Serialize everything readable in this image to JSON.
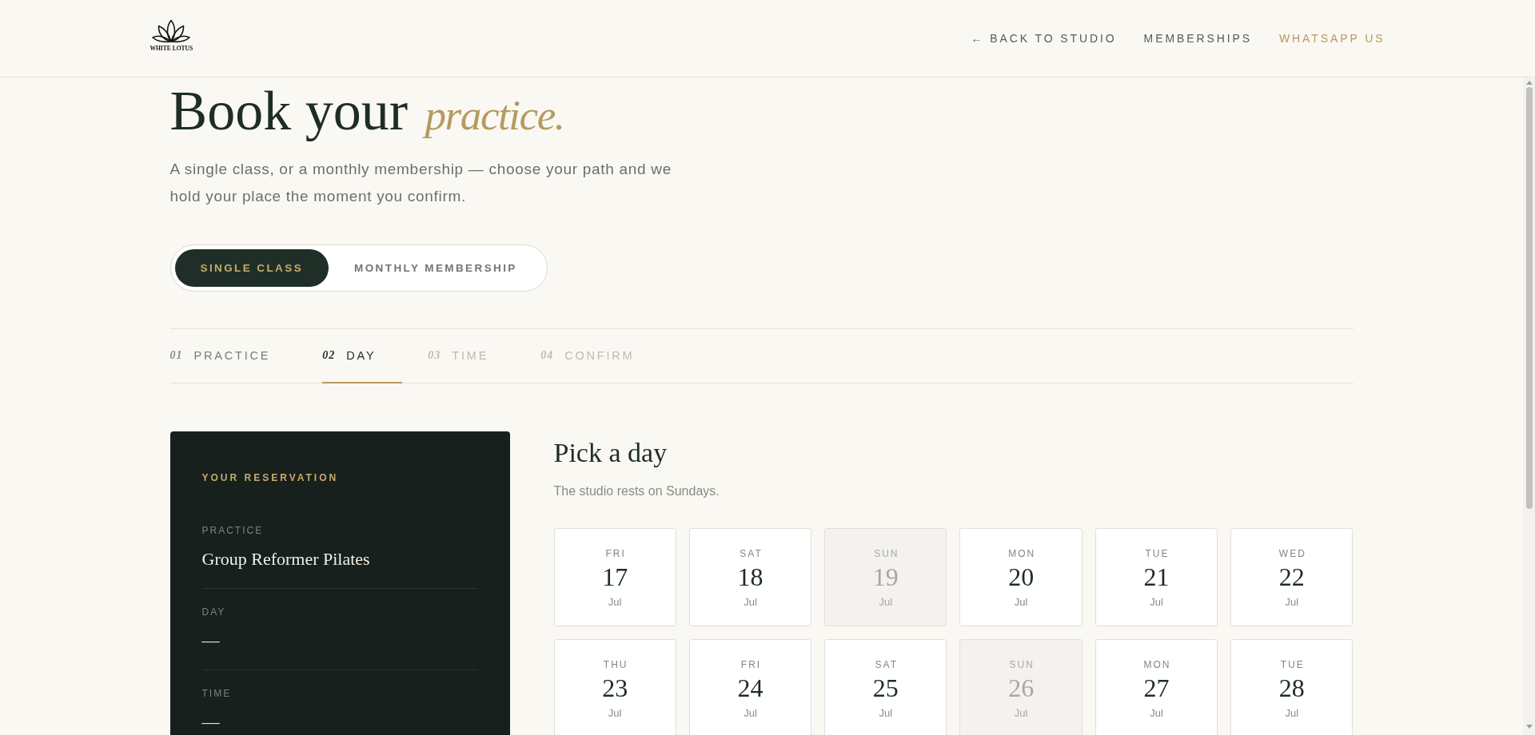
{
  "header": {
    "logo_text": "WHITE LOTUS",
    "nav": [
      {
        "label": "← BACK TO STUDIO",
        "accent": false
      },
      {
        "label": "MEMBERSHIPS",
        "accent": false
      },
      {
        "label": "WHATSAPP US",
        "accent": true
      }
    ]
  },
  "hero": {
    "title": "Book your *practice.*",
    "subtitle": "A single class, or a monthly membership — choose your path and we hold your place the moment you confirm."
  },
  "booking_type": [
    {
      "label": "SINGLE CLASS",
      "selected": true
    },
    {
      "label": "MONTHLY MEMBERSHIP",
      "selected": false
    }
  ],
  "steps": [
    {
      "number": "01",
      "label": "PRACTICE",
      "selected": false,
      "completed": true
    },
    {
      "number": "02",
      "label": "DAY",
      "selected": true,
      "completed": false
    },
    {
      "number": "03",
      "label": "TIME",
      "selected": false,
      "completed": false
    },
    {
      "number": "04",
      "label": "CONFIRM",
      "selected": false,
      "completed": false
    }
  ],
  "reservation": {
    "title": "YOUR RESERVATION",
    "fields": [
      {
        "label": "PRACTICE",
        "value": "Group Reformer Pilates"
      },
      {
        "label": "DAY",
        "value": "—"
      },
      {
        "label": "TIME",
        "value": "—"
      }
    ]
  },
  "day_picker": {
    "title": "Pick a day",
    "note": "The studio rests on Sundays.",
    "days": [
      {
        "weekday": "FRI",
        "day": "17",
        "month": "Jul",
        "disabled": false,
        "selected": false
      },
      {
        "weekday": "SAT",
        "day": "18",
        "month": "Jul",
        "disabled": false,
        "selected": false
      },
      {
        "weekday": "SUN",
        "day": "19",
        "month": "Jul",
        "disabled": true,
        "selected": false
      },
      {
        "weekday": "MON",
        "day": "20",
        "month": "Jul",
        "disabled": false,
        "selected": false
      },
      {
        "weekday": "TUE",
        "day": "21",
        "month": "Jul",
        "disabled": false,
        "selected": false
      },
      {
        "weekday": "WED",
        "day": "22",
        "month": "Jul",
        "disabled": false,
        "selected": false
      },
      {
        "weekday": "THU",
        "day": "23",
        "month": "Jul",
        "disabled": false,
        "selected": false
      },
      {
        "weekday": "FRI",
        "day": "24",
        "month": "Jul",
        "disabled": false,
        "selected": false
      },
      {
        "weekday": "SAT",
        "day": "25",
        "month": "Jul",
        "disabled": false,
        "selected": false
      },
      {
        "weekday": "SUN",
        "day": "26",
        "month": "Jul",
        "disabled": true,
        "selected": false
      },
      {
        "weekday": "MON",
        "day": "27",
        "month": "Jul",
        "disabled": false,
        "selected": false
      },
      {
        "weekday": "TUE",
        "day": "28",
        "month": "Jul",
        "disabled": false,
        "selected": false
      }
    ]
  }
}
